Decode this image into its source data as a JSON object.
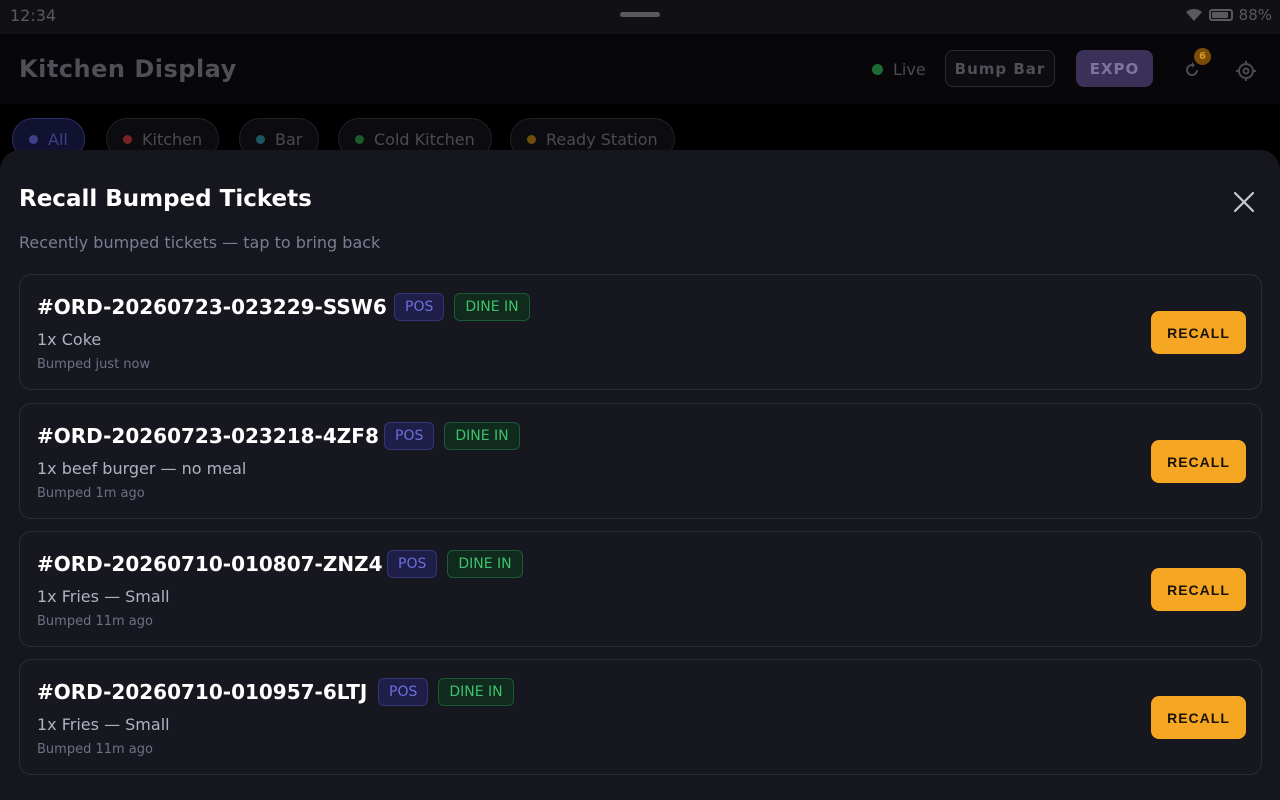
{
  "status_bar": {
    "time": "12:34",
    "battery": "88%"
  },
  "header": {
    "title": "Kitchen Display",
    "live_label": "Live",
    "bump_bar_label": "Bump Bar",
    "expo_label": "EXPO",
    "recall_count": "6"
  },
  "filters": [
    {
      "label": "All",
      "color": "#3f3f8a"
    },
    {
      "label": "Kitchen",
      "color": "#7a2323"
    },
    {
      "label": "Bar",
      "color": "#1c5561"
    },
    {
      "label": "Cold Kitchen",
      "color": "#1d5a2c"
    },
    {
      "label": "Ready Station",
      "color": "#6e4e0e"
    }
  ],
  "modal": {
    "title": "Recall Bumped Tickets",
    "subtitle": "Recently bumped tickets — tap to bring back",
    "recall_label": "RECALL",
    "tickets": [
      {
        "id": "#ORD-20260723-023229-SSW6",
        "source": "POS",
        "type": "DINE IN",
        "item": "1x Coke",
        "time": "Bumped just now"
      },
      {
        "id": "#ORD-20260723-023218-4ZF8",
        "source": "POS",
        "type": "DINE IN",
        "item": "1x beef burger — no meal",
        "time": "Bumped 1m ago"
      },
      {
        "id": "#ORD-20260710-010807-ZNZ4",
        "source": "POS",
        "type": "DINE IN",
        "item": "1x Fries — Small",
        "time": "Bumped 11m ago"
      },
      {
        "id": "#ORD-20260710-010957-6LTJ",
        "source": "POS",
        "type": "DINE IN",
        "item": "1x Fries — Small",
        "time": "Bumped 11m ago"
      }
    ]
  },
  "colors": {
    "accent": "#f5a623",
    "sheet_bg": "#16161f",
    "pos_tag": "#6e6ee0",
    "dine_tag": "#3cc26a"
  }
}
